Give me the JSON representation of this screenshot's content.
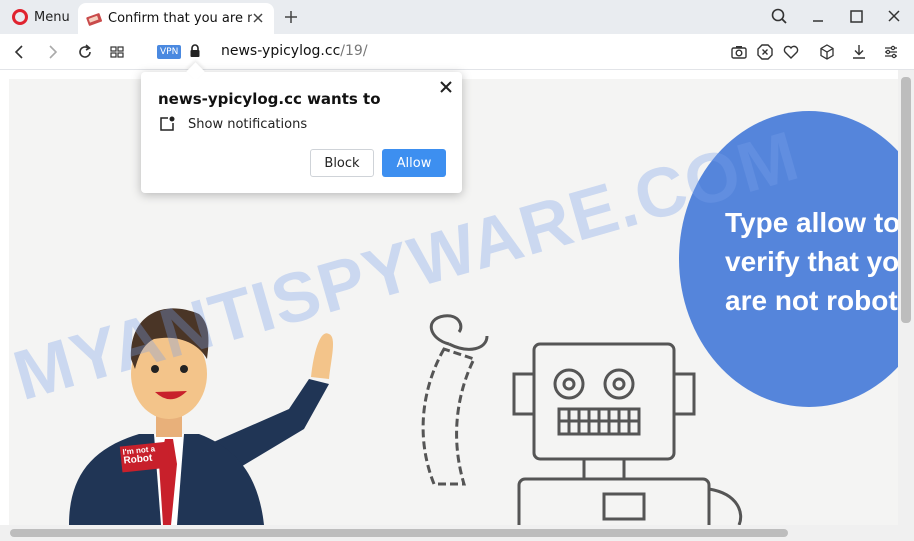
{
  "browser": {
    "menu_label": "Menu",
    "tab_title": "Confirm that you are not a robot",
    "address": {
      "vpn_badge": "VPN",
      "domain": "news-ypicylog.cc",
      "path": "/19/"
    }
  },
  "notification_prompt": {
    "title": "news-ypicylog.cc wants to",
    "permission": "Show notifications",
    "block_label": "Block",
    "allow_label": "Allow"
  },
  "page": {
    "circle_text": "Type allow to\nverify that you\nare not robot",
    "badge_line1": "I'm not a",
    "badge_line2": "Robot",
    "circle_color": "#5585db"
  },
  "watermark": "MYANTISPYWARE.COM",
  "colors": {
    "accent": "#3d8ff0",
    "opera_red": "#e0232f",
    "vpn_badge": "#4a89e0"
  },
  "icons": [
    "opera-logo-icon",
    "tab-favicon-icon",
    "close-tab-icon",
    "new-tab-icon",
    "search-icon",
    "minimize-icon",
    "maximize-icon",
    "close-window-icon",
    "back-icon",
    "forward-icon",
    "reload-icon",
    "speed-dial-icon",
    "lock-icon",
    "camera-icon",
    "adblock-icon",
    "heart-icon",
    "cube-icon",
    "download-icon",
    "easy-setup-icon",
    "notification-icon"
  ]
}
